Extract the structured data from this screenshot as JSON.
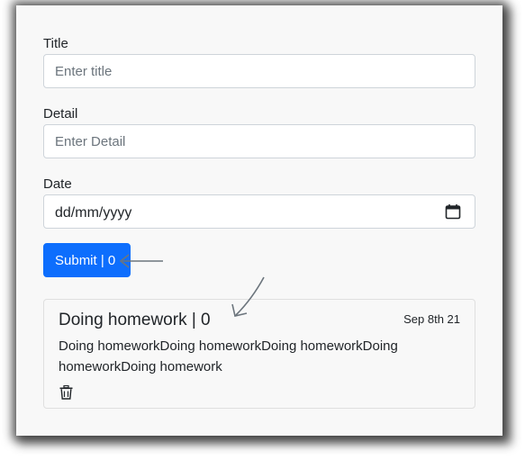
{
  "form": {
    "title_label": "Title",
    "title_placeholder": "Enter title",
    "detail_label": "Detail",
    "detail_placeholder": "Enter Detail",
    "date_label": "Date",
    "date_placeholder": "dd/mm/yyyy",
    "submit_label": "Submit | 0"
  },
  "task": {
    "title": "Doing homework | 0",
    "date": "Sep 8th 21",
    "detail": "Doing homeworkDoing homeworkDoing homeworkDoing homeworkDoing homework"
  },
  "icons": {
    "calendar": "calendar-icon",
    "delete": "trash-icon",
    "annotation": "arrow-annotation"
  },
  "colors": {
    "primary": "#0d6efd",
    "border": "#ced4da",
    "background": "#f8f8f8"
  }
}
